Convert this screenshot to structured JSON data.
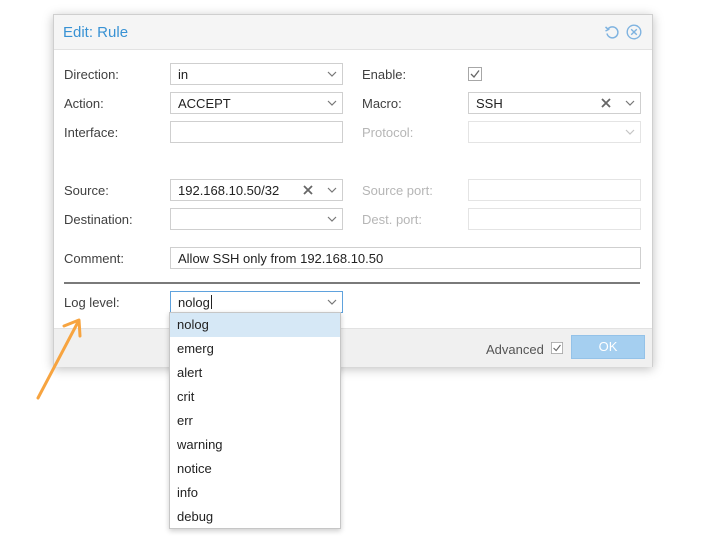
{
  "dialog": {
    "title": "Edit: Rule",
    "reset_icon": "reset-icon",
    "close_icon": "close-icon"
  },
  "form": {
    "direction": {
      "label": "Direction:",
      "value": "in"
    },
    "action": {
      "label": "Action:",
      "value": "ACCEPT"
    },
    "interface": {
      "label": "Interface:",
      "value": ""
    },
    "enable": {
      "label": "Enable:",
      "checked": true
    },
    "macro": {
      "label": "Macro:",
      "value": "SSH"
    },
    "protocol": {
      "label": "Protocol:",
      "value": ""
    },
    "source": {
      "label": "Source:",
      "value": "192.168.10.50/32"
    },
    "destination": {
      "label": "Destination:",
      "value": ""
    },
    "source_port": {
      "label": "Source port:",
      "value": ""
    },
    "dest_port": {
      "label": "Dest. port:",
      "value": ""
    },
    "comment": {
      "label": "Comment:",
      "value": "Allow SSH only from 192.168.10.50"
    },
    "log_level": {
      "label": "Log level:",
      "value": "nolog"
    }
  },
  "footer": {
    "advanced_label": "Advanced",
    "advanced_checked": true,
    "ok_label": "OK"
  },
  "log_options": [
    "nolog",
    "emerg",
    "alert",
    "crit",
    "err",
    "warning",
    "notice",
    "info",
    "debug"
  ],
  "selected_option": "nolog",
  "colors": {
    "accent": "#3892d4",
    "highlight": "#d6e8f6",
    "arrow": "#f7a440"
  }
}
